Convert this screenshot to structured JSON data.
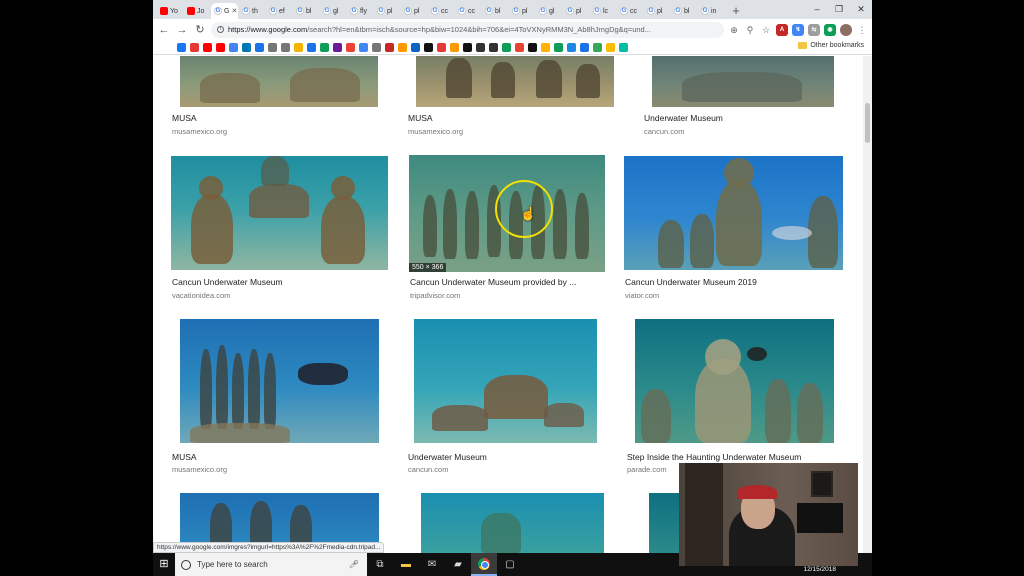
{
  "browser": {
    "tabs": [
      {
        "label": "Yo",
        "icon": "youtube-icon"
      },
      {
        "label": "Jo",
        "icon": "youtube-icon"
      },
      {
        "label": "G",
        "icon": "google-icon",
        "active": true
      },
      {
        "label": "th",
        "icon": "google-icon"
      },
      {
        "label": "ef",
        "icon": "google-icon"
      },
      {
        "label": "bl",
        "icon": "google-icon"
      },
      {
        "label": "gl",
        "icon": "google-icon"
      },
      {
        "label": "fly",
        "icon": "google-icon"
      },
      {
        "label": "pl",
        "icon": "google-icon"
      },
      {
        "label": "pl",
        "icon": "google-icon"
      },
      {
        "label": "cc",
        "icon": "google-icon"
      },
      {
        "label": "cc",
        "icon": "google-icon"
      },
      {
        "label": "bl",
        "icon": "google-icon"
      },
      {
        "label": "pl",
        "icon": "google-icon"
      },
      {
        "label": "gl",
        "icon": "google-icon"
      },
      {
        "label": "pl",
        "icon": "google-icon"
      },
      {
        "label": "lc",
        "icon": "google-icon"
      },
      {
        "label": "cc",
        "icon": "google-icon"
      },
      {
        "label": "pl",
        "icon": "google-icon"
      },
      {
        "label": "bl",
        "icon": "google-icon"
      },
      {
        "label": "in",
        "icon": "google-icon"
      }
    ],
    "url_host": "https://www.google.com",
    "url_rest": "/search?hl=en&tbm=isch&source=hp&biw=1024&bih=706&ei=4ToVXNyRMM3N_Ab8hJmgDg&q=und...",
    "other_bookmarks": "Other bookmarks",
    "bookmark_colors": [
      "#1877f2",
      "#e53935",
      "#ff0000",
      "#ff0000",
      "#4285f4",
      "#0077b5",
      "#1a73e8",
      "#777",
      "#777",
      "#f4b400",
      "#1a73e8",
      "#0f9d58",
      "#6a1b9a",
      "#ea4335",
      "#4285f4",
      "#777",
      "#c62828",
      "#ff9800",
      "#0a66c2",
      "#111",
      "#e53935",
      "#ff9900",
      "#111",
      "#333",
      "#333",
      "#0f9d58",
      "#ea4335",
      "#111",
      "#ffb300",
      "#0f9d58",
      "#1e88e5",
      "#1a73e8",
      "#34a853",
      "#fbbc05",
      "#00bfa5"
    ]
  },
  "results": [
    {
      "caption": "MUSA",
      "source": "musamexico.org"
    },
    {
      "caption": "MUSA",
      "source": "musamexico.org"
    },
    {
      "caption": "Underwater Museum",
      "source": "cancun.com"
    },
    {
      "caption": "Cancun Underwater Museum",
      "source": "vacationidea.com"
    },
    {
      "caption": "Cancun Underwater Museum provided by ...",
      "source": "tripadvisor.com",
      "dims": "550 × 366"
    },
    {
      "caption": "Cancun Underwater Museum 2019",
      "source": "viator.com"
    },
    {
      "caption": "MUSA",
      "source": "musamexico.org"
    },
    {
      "caption": "Underwater Museum",
      "source": "cancun.com"
    },
    {
      "caption": "Step Inside the Haunting Underwater Museum",
      "source": "parade.com"
    }
  ],
  "status_url": "https://www.google.com/imgres?imgurl=https%3A%2F%2Fmedia-cdn.tripad...",
  "taskbar": {
    "search_placeholder": "Type here to search",
    "date": "12/15/2018"
  }
}
